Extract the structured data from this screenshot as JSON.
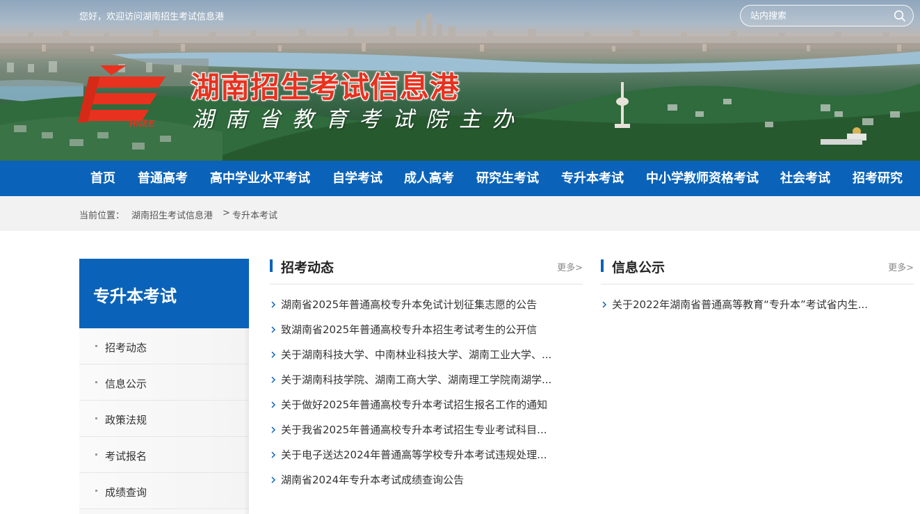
{
  "topbar": {
    "welcome": "您好，欢迎访问湖南招生考试信息港",
    "search_placeholder": "站内搜索"
  },
  "header": {
    "title": "湖南招生考试信息港",
    "subtitle": "湖南省教育考试院主办",
    "logo_text": "HNEE"
  },
  "nav": {
    "items": [
      "首页",
      "普通高考",
      "高中学业水平考试",
      "自学考试",
      "成人高考",
      "研究生考试",
      "专升本考试",
      "中小学教师资格考试",
      "社会考试",
      "招考研究"
    ]
  },
  "breadcrumb": {
    "prefix": "当前位置：",
    "home": "湖南招生考试信息港",
    "separator": ">",
    "current": "专升本考试"
  },
  "sidebar": {
    "title": "专升本考试",
    "items": [
      "招考动态",
      "信息公示",
      "政策法规",
      "考试报名",
      "成绩查询"
    ]
  },
  "news": {
    "title": "招考动态",
    "more": "更多>",
    "items": [
      "湖南省2025年普通高校专升本免试计划征集志愿的公告",
      "致湖南省2025年普通高校专升本招生考试考生的公开信",
      "关于湖南科技大学、中南林业科技大学、湖南工业大学、...",
      "关于湖南科技学院、湖南工商大学、湖南理工学院南湖学...",
      "关于做好2025年普通高校专升本考试招生报名工作的通知",
      "关于我省2025年普通高校专升本考试招生专业考试科目...",
      "关于电子送达2024年普通高等学校专升本考试违规处理...",
      "湖南省2024年专升本考试成绩查询公告"
    ]
  },
  "notice": {
    "title": "信息公示",
    "more": "更多>",
    "items": [
      "关于2022年湖南省普通高等教育“专升本”考试省内生..."
    ]
  },
  "colors": {
    "brand_blue": "#0a63b8",
    "title_red": "#e8321f"
  }
}
